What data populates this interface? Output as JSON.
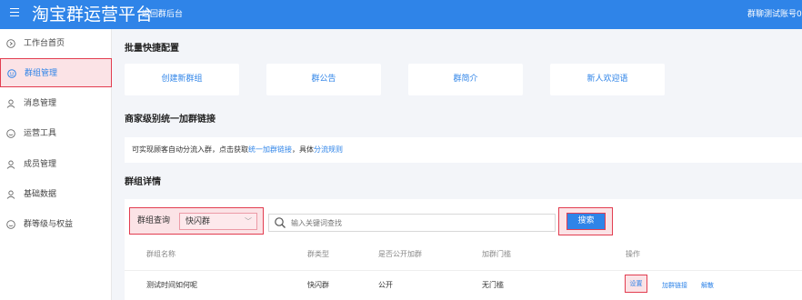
{
  "header": {
    "app_title": "淘宝群运营平台",
    "back_link": "返回群后台",
    "account": "群聊测试账号0"
  },
  "sidebar": {
    "items": [
      {
        "label": "工作台首页",
        "icon": "home-icon"
      },
      {
        "label": "群组管理",
        "icon": "group-icon",
        "active": true
      },
      {
        "label": "消息管理",
        "icon": "message-icon"
      },
      {
        "label": "运营工具",
        "icon": "tools-icon"
      },
      {
        "label": "成员管理",
        "icon": "member-icon"
      },
      {
        "label": "基础数据",
        "icon": "data-icon"
      },
      {
        "label": "群等级与权益",
        "icon": "level-icon"
      }
    ]
  },
  "quick_config": {
    "title": "批量快捷配置",
    "cards": [
      "创建新群组",
      "群公告",
      "群简介",
      "新人欢迎语"
    ]
  },
  "merchant_link": {
    "title": "商家级别统一加群链接",
    "text_prefix": "可实现顾客自动分流入群，点击获取",
    "link1": "统一加群链接",
    "text_middle": "，具体",
    "link2": "分流规则"
  },
  "group_detail": {
    "title": "群组详情",
    "filter_label": "群组查询",
    "filter_value": "快闪群",
    "search_placeholder": "输入关键词查找",
    "search_button": "搜索",
    "columns": [
      "群组名称",
      "群类型",
      "是否公开加群",
      "加群门槛",
      "操作"
    ],
    "rows": [
      {
        "name": "测试时间如何呢",
        "type": "快闪群",
        "public": "公开",
        "threshold": "无门槛",
        "actions": [
          "设置",
          "加群链接",
          "解散"
        ]
      }
    ]
  },
  "colors": {
    "primary": "#2f84e8",
    "highlight_border": "#e23d50",
    "highlight_fill": "#fbe3e6"
  }
}
